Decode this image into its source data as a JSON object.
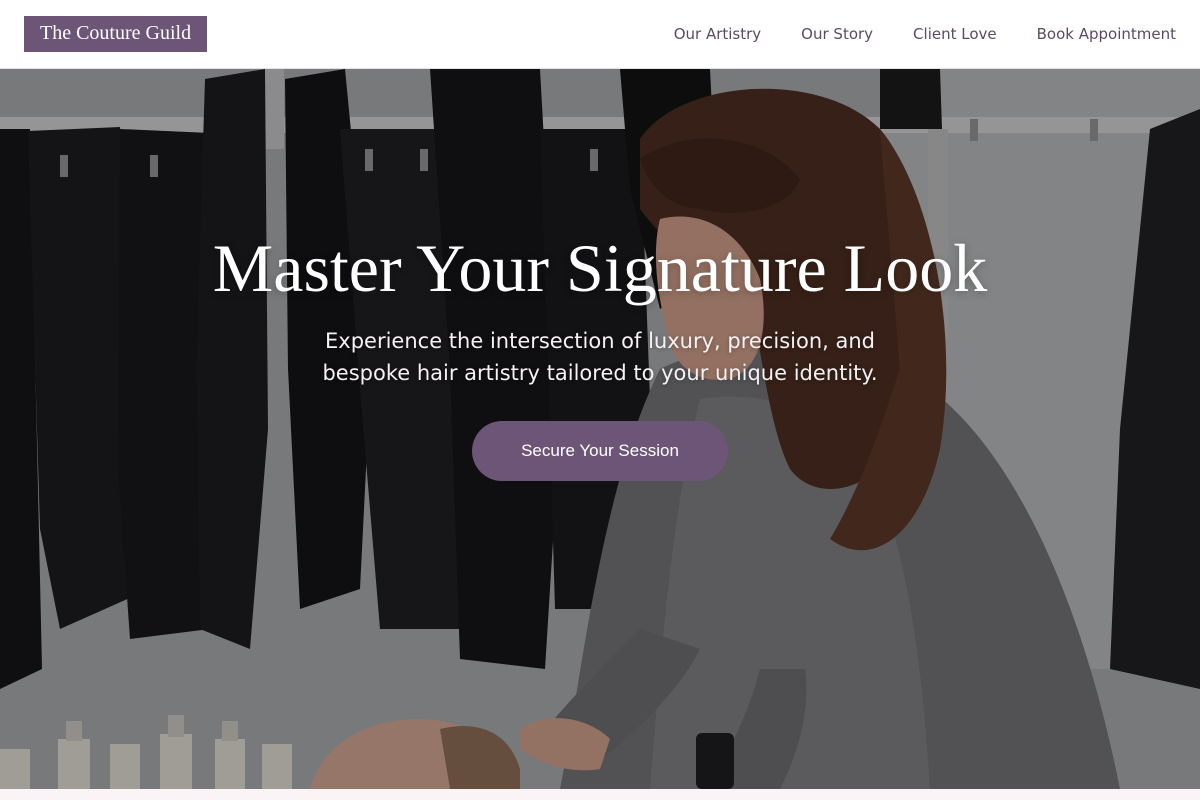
{
  "brand": {
    "name": "The Couture Guild",
    "accent_color": "#6d5578"
  },
  "nav": {
    "items": [
      {
        "label": "Our Artistry"
      },
      {
        "label": "Our Story"
      },
      {
        "label": "Client Love"
      },
      {
        "label": "Book Appointment"
      }
    ]
  },
  "hero": {
    "title": "Master Your Signature Look",
    "subtitle": "Experience the intersection of luxury, precision, and bespoke hair artistry tailored to your unique identity.",
    "cta_label": "Secure Your Session",
    "background_image": "stylist washing a client's hair in a salon with black towels hanging behind"
  }
}
